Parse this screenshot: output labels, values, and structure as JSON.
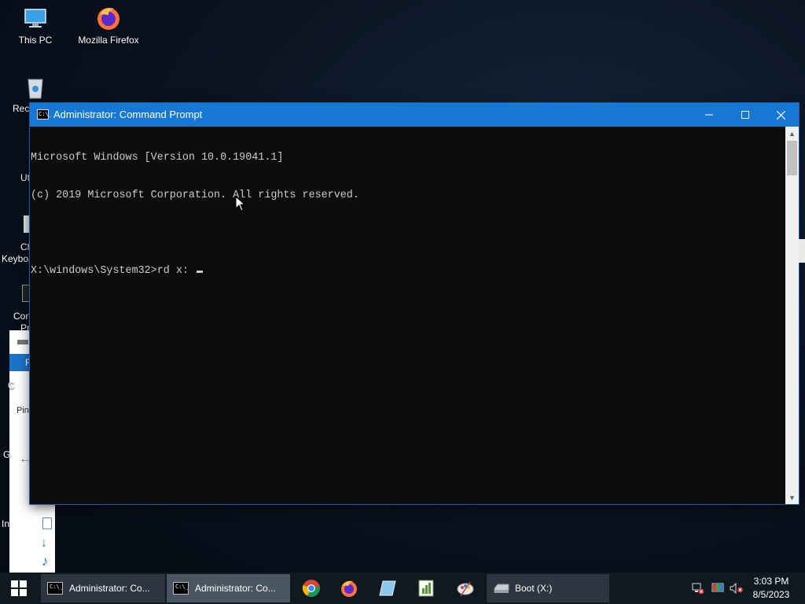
{
  "desktop": {
    "icons": [
      {
        "label": "This PC"
      },
      {
        "label": "Mozilla Firefox"
      }
    ],
    "partial_labels": [
      "Recy",
      "Ut",
      "Ch",
      "Keyboa",
      "Con",
      "Pr",
      "Pin",
      "G",
      "In",
      "F",
      "C"
    ]
  },
  "cmd_window": {
    "title": "Administrator: Command Prompt",
    "icon_text": "C:\\_",
    "lines": [
      "Microsoft Windows [Version 10.0.19041.1]",
      "(c) 2019 Microsoft Corporation. All rights reserved.",
      "",
      "X:\\windows\\System32>rd x: "
    ],
    "buttons": {
      "minimize": "minimize",
      "maximize": "maximize",
      "close": "close"
    }
  },
  "taskbar": {
    "items": [
      {
        "label": "Administrator: Co..."
      },
      {
        "label": "Administrator: Co..."
      }
    ],
    "pinned": [
      "chrome-icon",
      "firefox-icon",
      "notepad-icon",
      "spreadsheet-icon",
      "paint-icon"
    ],
    "drive_item": {
      "label": "Boot (X:)"
    },
    "clock": {
      "time": "3:03 PM",
      "date": "8/5/2023"
    }
  },
  "colors": {
    "titlebar": "#1677d4",
    "console_bg": "#0c0c0c",
    "console_text": "#cccccc",
    "taskbar": "#101820"
  }
}
